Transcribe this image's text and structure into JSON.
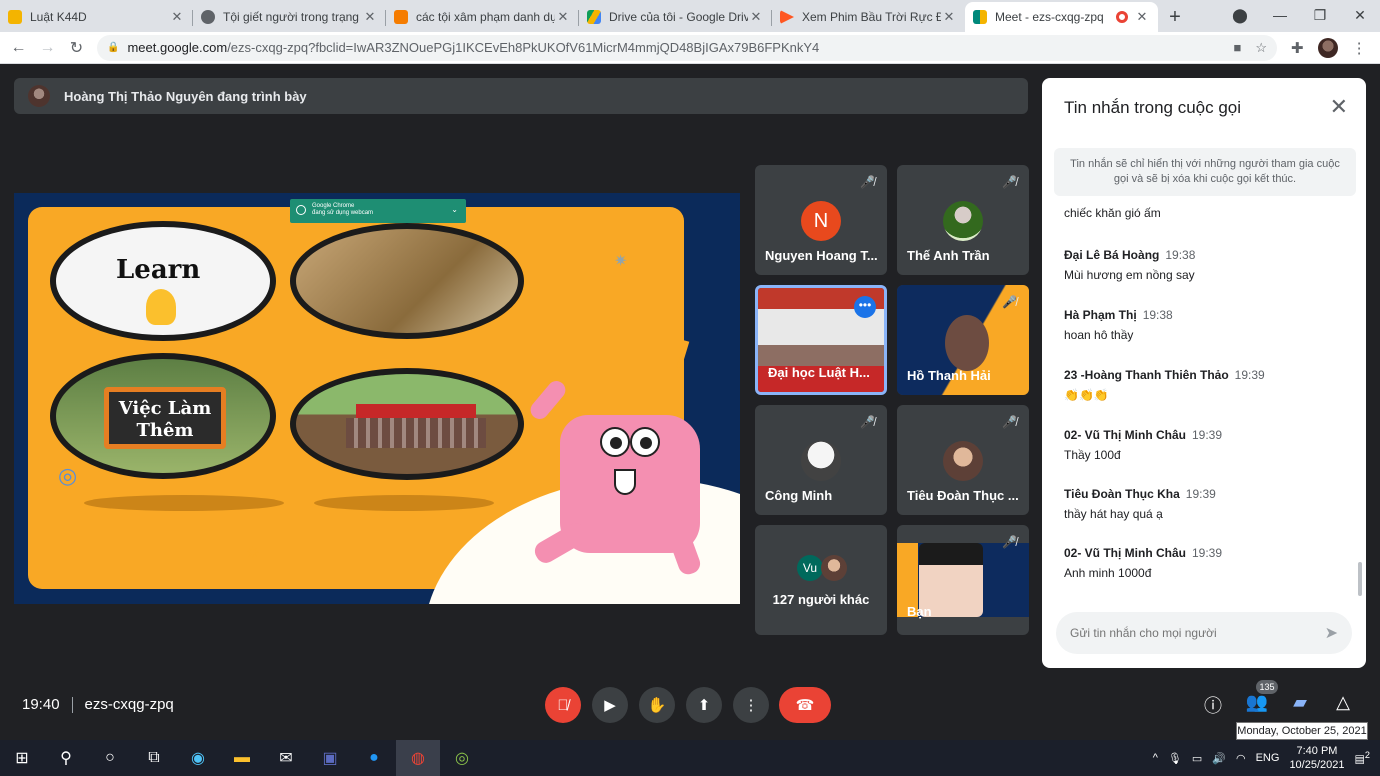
{
  "tabs": [
    {
      "title": "Luật K44D",
      "color": "#f4b400",
      "active": false
    },
    {
      "title": "Tội giết người trong trạng thái",
      "color": "#5f6368",
      "active": false
    },
    {
      "title": "các tội xâm phạm danh dự, nhân",
      "color": "#f57c00",
      "active": false
    },
    {
      "title": "Drive của tôi - Google Drive",
      "color": "#1a73e8",
      "active": false
    },
    {
      "title": "Xem Phim Bầu Trời Rực Đỏ",
      "color": "#ff5722",
      "active": false
    },
    {
      "title": "Meet - ezs-cxqg-zpq",
      "color": "#00897b",
      "active": true
    }
  ],
  "toolbar": {
    "url_host": "meet.google.com",
    "url_path": "/ezs-cxqg-zpq?fbclid=IwAR3ZNOuePGj1IKCEvEh8PkUKOfV61MicrM4mmjQD48BjIGAx79B6FPKnkY4"
  },
  "presenter": {
    "text": "Hoàng Thị Thảo Nguyên đang trình bày"
  },
  "slide": {
    "learn_text": "Learn",
    "job_text_1": "Việc Làm",
    "job_text_2": "Thêm",
    "popup_line1": "Google Chrome",
    "popup_line2": "đang sử dụng webcam"
  },
  "tiles": [
    {
      "name": "Nguyen Hoang T...",
      "initial": "N"
    },
    {
      "name": "Thế Anh Trần"
    },
    {
      "name": "Đại học Luật H..."
    },
    {
      "name": "Hồ Thanh Hải"
    },
    {
      "name": "Công Minh"
    },
    {
      "name": "Tiêu Đoàn Thục ..."
    },
    {
      "name": "127 người khác",
      "initial": "Vu"
    },
    {
      "name": "Bạn"
    }
  ],
  "chat": {
    "title": "Tin nhắn trong cuộc gọi",
    "notice": "Tin nhắn sẽ chỉ hiển thị với những người tham gia cuộc gọi và sẽ bị xóa khi cuộc gọi kết thúc.",
    "partial_message": "chiếc khăn gió ấm",
    "messages": [
      {
        "sender": "Đại Lê Bá Hoàng",
        "time": "19:38",
        "body": "Mùi hương em nồng say"
      },
      {
        "sender": "Hà Phạm Thị",
        "time": "19:38",
        "body": "hoan hô thầy"
      },
      {
        "sender": "23 -Hoàng Thanh Thiên Thảo",
        "time": "19:39",
        "body": "👏👏👏"
      },
      {
        "sender": "02- Vũ Thị Minh Châu",
        "time": "19:39",
        "body": "Thầy 100đ"
      },
      {
        "sender": "Tiêu Đoàn Thục Kha",
        "time": "19:39",
        "body": "thầy hát hay quá ạ"
      },
      {
        "sender": "02- Vũ Thị Minh Châu",
        "time": "19:39",
        "body": "Anh minh 1000đ"
      }
    ],
    "input_placeholder": "Gửi tin nhắn cho mọi người"
  },
  "meeting": {
    "time": "19:40",
    "code": "ezs-cxqg-zpq",
    "participant_count": "135"
  },
  "tooltip": "Monday, October 25, 2021",
  "taskbar": {
    "lang": "ENG",
    "time": "7:40 PM",
    "date": "10/25/2021",
    "notif": "2"
  }
}
